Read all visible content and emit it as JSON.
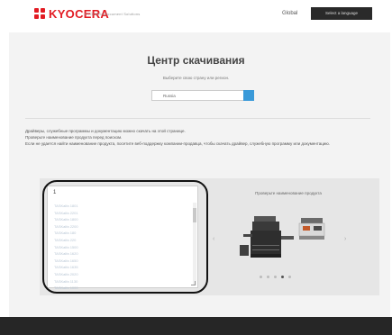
{
  "header": {
    "brand": "KYOCERA",
    "tagline": "KYOCERA Document Solutions",
    "global_label": "Global",
    "language_button": "Select a language"
  },
  "main": {
    "title": "Центр скачивания",
    "subtitle": "Выберите свою страну или регион.",
    "region_value": "Russia",
    "info_lines": [
      "Драйверы, служебные программы и документацию можно скачать на этой странице.",
      "Проверьте наименование продукта перед поиском.",
      "Если не удается найти наименование продукта, посетите веб-поддержку компании-продавца, чтобы скачать драйвер, служебную программу или документацию."
    ]
  },
  "search": {
    "input_value": "1",
    "suggestions": [
      "TASKalfa 1801",
      "TASKalfa 2201",
      "TASKalfa 1800",
      "TASKalfa 2200",
      "TASKalfa 180",
      "TASKalfa 220",
      "TASKalfa 1500",
      "TASKalfa 1620",
      "TASKalfa 1650",
      "TASKalfa 1635",
      "TASKalfa 2020",
      "TASKalfa 1130",
      "TASKalfa 1000"
    ]
  },
  "preview": {
    "title": "Проверьте наименование продукта",
    "prev_arrow": "‹",
    "next_arrow": "›",
    "dots_count": 5,
    "active_dot": 4
  },
  "colors": {
    "brand_red": "#e21b23",
    "accent_blue": "#3a9ad9",
    "footer": "#262626"
  }
}
